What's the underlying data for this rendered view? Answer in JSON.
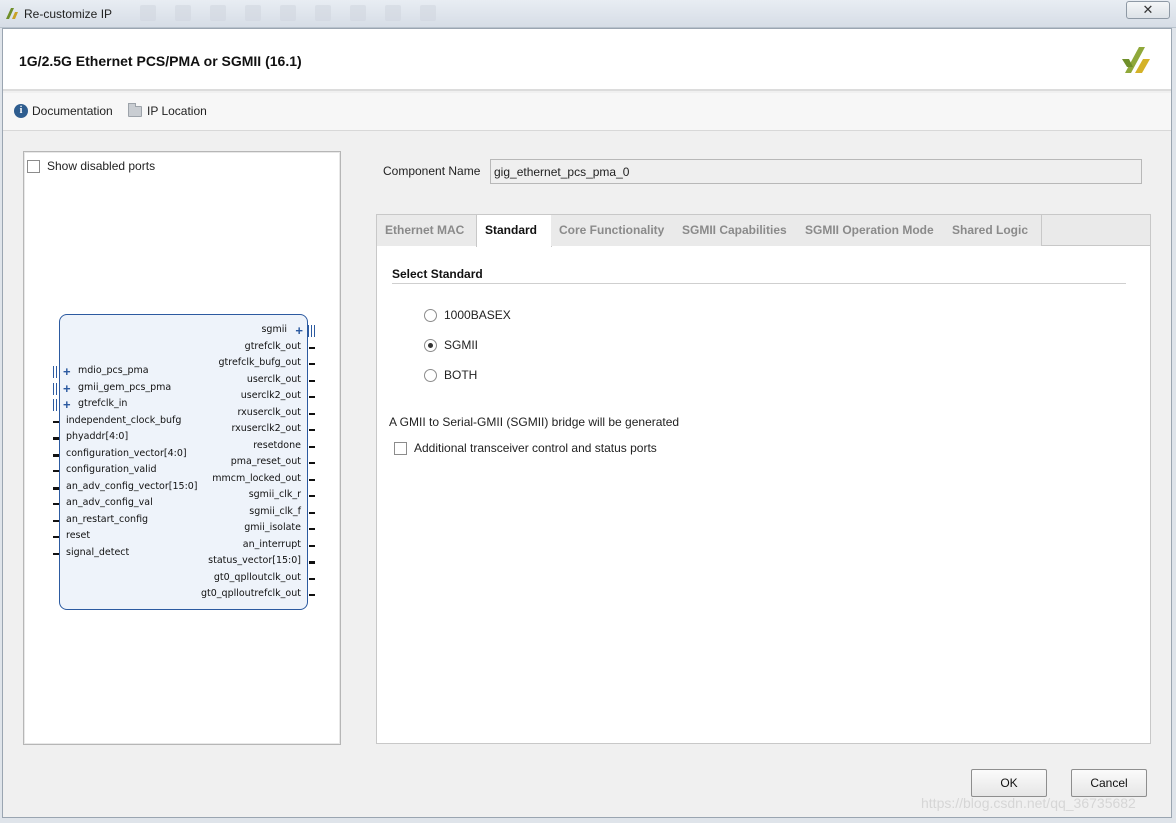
{
  "window": {
    "title": "Re-customize IP",
    "close_glyph": "✕"
  },
  "header": {
    "title": "1G/2.5G Ethernet PCS/PMA or SGMII (16.1)",
    "logo_icon": "xilinx-logo"
  },
  "toolbar": {
    "documentation_label": "Documentation",
    "documentation_icon": "info-icon",
    "ip_location_label": "IP Location",
    "ip_location_icon": "folder-icon"
  },
  "symbol": {
    "show_disabled_label": "Show disabled ports",
    "show_disabled_checked": false,
    "left_bus_ports": [
      "mdio_pcs_pma",
      "gmii_gem_pcs_pma",
      "gtrefclk_in"
    ],
    "left_ports": [
      "independent_clock_bufg",
      "phyaddr[4:0]",
      "configuration_vector[4:0]",
      "configuration_valid",
      "an_adv_config_vector[15:0]",
      "an_adv_config_val",
      "an_restart_config",
      "reset",
      "signal_detect"
    ],
    "right_bus_port": "sgmii",
    "right_ports": [
      "gtrefclk_out",
      "gtrefclk_bufg_out",
      "userclk_out",
      "userclk2_out",
      "rxuserclk_out",
      "rxuserclk2_out",
      "resetdone",
      "pma_reset_out",
      "mmcm_locked_out",
      "sgmii_clk_r",
      "sgmii_clk_f",
      "gmii_isolate",
      "an_interrupt",
      "status_vector[15:0]",
      "gt0_qplloutclk_out",
      "gt0_qplloutrefclk_out"
    ]
  },
  "component": {
    "label": "Component Name",
    "value": "gig_ethernet_pcs_pma_0"
  },
  "tabs": [
    {
      "label": "Ethernet MAC",
      "active": false
    },
    {
      "label": "Standard",
      "active": true
    },
    {
      "label": "Core Functionality",
      "active": false
    },
    {
      "label": "SGMII Capabilities",
      "active": false
    },
    {
      "label": "SGMII Operation Mode",
      "active": false
    },
    {
      "label": "Shared Logic",
      "active": false
    }
  ],
  "standard": {
    "section_title": "Select Standard",
    "options": [
      {
        "label": "1000BASEX",
        "checked": false
      },
      {
        "label": "SGMII",
        "checked": true
      },
      {
        "label": "BOTH",
        "checked": false
      }
    ],
    "description": "A GMII to Serial-GMII (SGMII) bridge will be generated",
    "additional_ports_label": "Additional transceiver control and status ports",
    "additional_ports_checked": false
  },
  "buttons": {
    "ok": "OK",
    "cancel": "Cancel"
  },
  "watermark": "https://blog.csdn.net/qq_36735682"
}
